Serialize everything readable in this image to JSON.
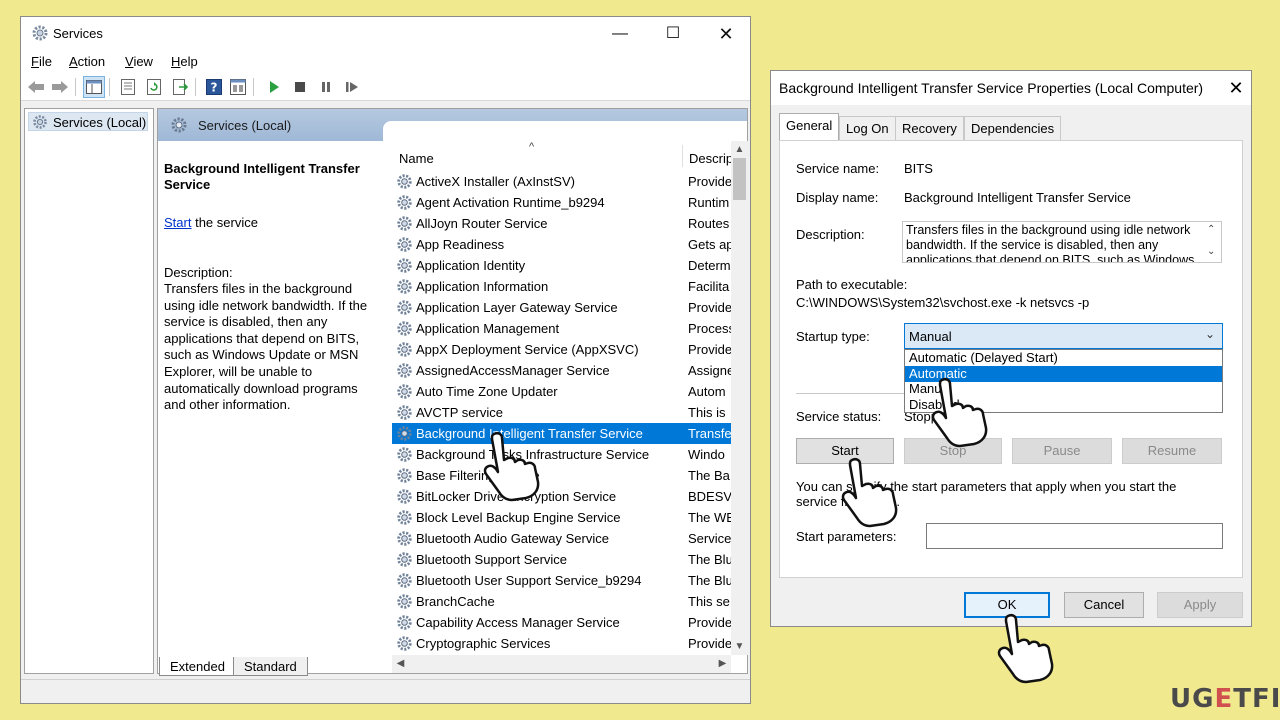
{
  "services_window": {
    "title": "Services",
    "menu": [
      "File",
      "Action",
      "View",
      "Help"
    ],
    "menu_underline": [
      "F",
      "A",
      "V",
      "H"
    ],
    "tree_item": "Services (Local)",
    "main_header": "Services (Local)",
    "detail": {
      "title": "Background Intelligent Transfer Service",
      "start_link": "Start",
      "start_suffix": " the service",
      "description_label": "Description:",
      "description": "Transfers files in the background using idle network bandwidth. If the service is disabled, then any applications that depend on BITS, such as Windows Update or MSN Explorer, will be unable to automatically download programs and other information."
    },
    "columns": {
      "name": "Name",
      "description": "Descrip",
      "sort_indicator": "^"
    },
    "rows": [
      {
        "name": "ActiveX Installer (AxInstSV)",
        "desc": "Provide"
      },
      {
        "name": "Agent Activation Runtime_b9294",
        "desc": "Runtim"
      },
      {
        "name": "AllJoyn Router Service",
        "desc": "Routes"
      },
      {
        "name": "App Readiness",
        "desc": "Gets ap"
      },
      {
        "name": "Application Identity",
        "desc": "Determ"
      },
      {
        "name": "Application Information",
        "desc": "Facilita"
      },
      {
        "name": "Application Layer Gateway Service",
        "desc": "Provide"
      },
      {
        "name": "Application Management",
        "desc": "Process"
      },
      {
        "name": "AppX Deployment Service (AppXSVC)",
        "desc": "Provide"
      },
      {
        "name": "AssignedAccessManager Service",
        "desc": "Assigne"
      },
      {
        "name": "Auto Time Zone Updater",
        "desc": "Autom"
      },
      {
        "name": "AVCTP service",
        "desc": "This is"
      },
      {
        "name": "Background Intelligent Transfer Service",
        "desc": "Transfe",
        "selected": true
      },
      {
        "name": "Background Tasks Infrastructure Service",
        "desc": "Windo"
      },
      {
        "name": "Base Filtering Engine",
        "desc": "The Ba"
      },
      {
        "name": "BitLocker Drive Encryption Service",
        "desc": "BDESV"
      },
      {
        "name": "Block Level Backup Engine Service",
        "desc": "The WE"
      },
      {
        "name": "Bluetooth Audio Gateway Service",
        "desc": "Service"
      },
      {
        "name": "Bluetooth Support Service",
        "desc": "The Blu"
      },
      {
        "name": "Bluetooth User Support Service_b9294",
        "desc": "The Blu"
      },
      {
        "name": "BranchCache",
        "desc": "This se"
      },
      {
        "name": "Capability Access Manager Service",
        "desc": "Provide"
      },
      {
        "name": "Cryptographic Services",
        "desc": "Provide"
      }
    ],
    "bottom_tabs": [
      "Extended",
      "Standard"
    ]
  },
  "properties_dialog": {
    "title": "Background Intelligent Transfer Service Properties (Local Computer)",
    "tabs": [
      "General",
      "Log On",
      "Recovery",
      "Dependencies"
    ],
    "service_name_label": "Service name:",
    "service_name": "BITS",
    "display_name_label": "Display name:",
    "display_name": "Background Intelligent Transfer Service",
    "description_label": "Description:",
    "description": "Transfers files in the background using idle network bandwidth. If the service is disabled, then any applications that depend on BITS, such as Windows",
    "path_label": "Path to executable:",
    "path": "C:\\WINDOWS\\System32\\svchost.exe -k netsvcs -p",
    "startup_type_label": "Startup type:",
    "startup_type": "Manual",
    "startup_options": [
      "Automatic (Delayed Start)",
      "Automatic",
      "Manual",
      "Disabled"
    ],
    "startup_highlight_index": 1,
    "service_status_label": "Service status:",
    "service_status": "Stopped",
    "buttons": {
      "start": "Start",
      "stop": "Stop",
      "pause": "Pause",
      "resume": "Resume"
    },
    "hint": "You can specify the start parameters that apply when you start the service from here.",
    "start_params_label": "Start parameters:",
    "ok": "OK",
    "cancel": "Cancel",
    "apply": "Apply"
  },
  "watermark": {
    "left": "UG",
    "mid": "E",
    "right": "TFIX"
  },
  "colors": {
    "background": "#f0e98e",
    "selection": "#0078d7",
    "link": "#0033cc"
  }
}
